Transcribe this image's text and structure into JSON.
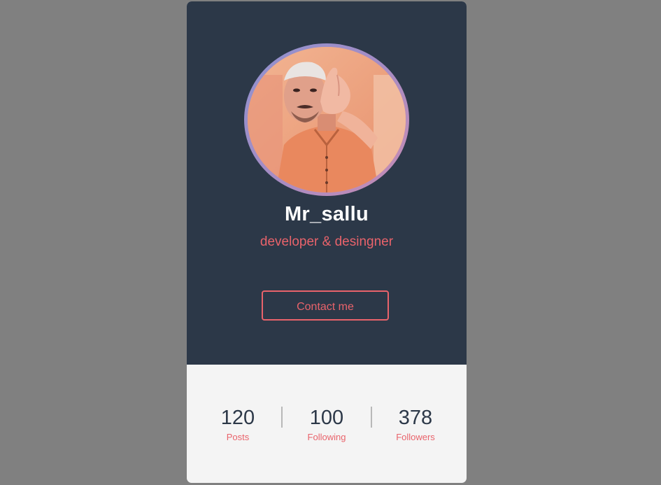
{
  "profile": {
    "name": "Mr_sallu",
    "role": "developer & desingner",
    "avatar_icon": "profile-photo",
    "contact_label": "Contact me"
  },
  "stats": [
    {
      "value": "120",
      "label": "Posts"
    },
    {
      "value": "100",
      "label": "Following"
    },
    {
      "value": "378",
      "label": "Followers"
    }
  ],
  "colors": {
    "background": "#808080",
    "card_top": "#2c3848",
    "card_bottom": "#f4f4f4",
    "accent": "#e9636b",
    "ring_gradient": [
      "#8f92d0",
      "#c98bb3"
    ]
  }
}
